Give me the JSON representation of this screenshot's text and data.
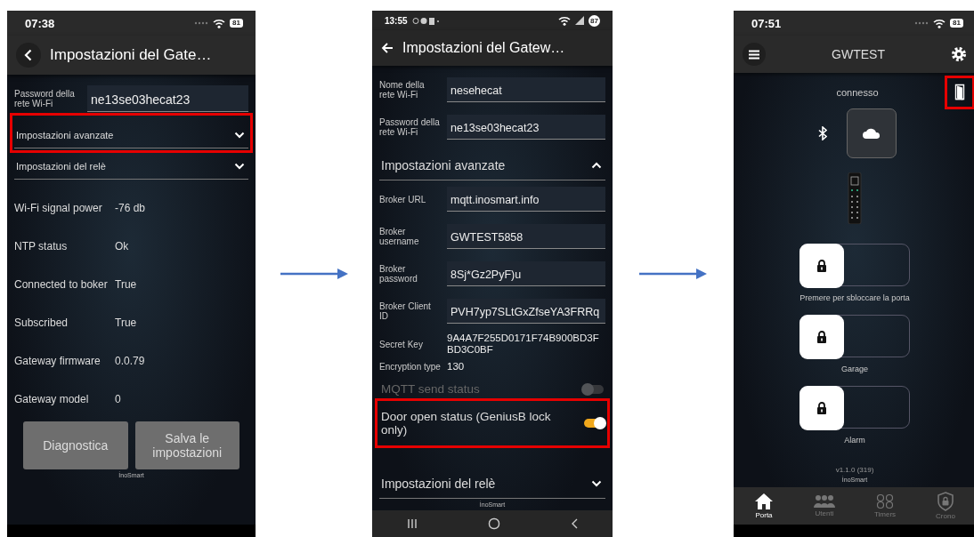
{
  "screens": [
    {
      "kind": "settings",
      "status_bar": {
        "kind": "ios",
        "time": "07:38",
        "battery": "81"
      },
      "header": {
        "title": "Impostazioni del Gate…"
      },
      "rows": [
        {
          "kind": "field",
          "label": "Password della rete Wi-Fi",
          "value": "ne13se03hecat23"
        },
        {
          "kind": "accordion",
          "title": "Impostazioni avanzate",
          "expanded": false,
          "highlighted": true
        },
        {
          "kind": "accordion",
          "title": "Impostazioni del relè",
          "expanded": false
        },
        {
          "kind": "info",
          "label": "Wi-Fi signal power",
          "value": "-76 db"
        },
        {
          "kind": "info",
          "label": "NTP status",
          "value": "Ok"
        },
        {
          "kind": "info",
          "label": "Connected to boker",
          "value": "True"
        },
        {
          "kind": "info",
          "label": "Subscribed",
          "value": "True"
        },
        {
          "kind": "info",
          "label": "Gateway firmware",
          "value": "0.0.79"
        },
        {
          "kind": "info",
          "label": "Gateway model",
          "value": "0"
        },
        {
          "kind": "buttons",
          "buttons": [
            "Diagnostica",
            "Salva le impostazioni"
          ]
        }
      ],
      "footer": "İnoSmart"
    },
    {
      "kind": "settings",
      "status_bar": {
        "kind": "android",
        "time": "13:55",
        "battery": "87"
      },
      "header": {
        "title": "Impostazioni del Gatew…"
      },
      "rows": [
        {
          "kind": "field",
          "label": "Nome della rete Wi-Fi",
          "value": "nesehecat"
        },
        {
          "kind": "field",
          "label": "Password della rete Wi-Fi",
          "value": "ne13se03hecat23"
        },
        {
          "kind": "accordion",
          "title": "Impostazioni avanzate",
          "expanded": true
        },
        {
          "kind": "field",
          "label": "Broker URL",
          "value": "mqtt.inosmart.info"
        },
        {
          "kind": "field",
          "label": "Broker username",
          "value": "GWTEST5858"
        },
        {
          "kind": "field",
          "label": "Broker password",
          "value": "8Sj*Gz2PyF)u"
        },
        {
          "kind": "field",
          "label": "Broker Client ID",
          "value": "PVH7yp7SLtGxZfseYA3FRRq"
        },
        {
          "kind": "text",
          "label": "Secret Key",
          "value": "9A4A7F255D0171F74B900BD3FBD3C0BF"
        },
        {
          "kind": "text",
          "label": "Encryption type",
          "value": "130"
        },
        {
          "kind": "toggle",
          "label": "MQTT send status",
          "on": false,
          "disabled": true
        },
        {
          "kind": "toggle",
          "label": "Door open status (GeniusB lock only)",
          "on": true,
          "disabled": false,
          "highlighted": true
        },
        {
          "kind": "accordion",
          "title": "Impostazioni del relè",
          "expanded": false
        }
      ],
      "footer": "İnoSmart"
    },
    {
      "kind": "home",
      "status_bar": {
        "kind": "ios",
        "time": "07:51",
        "battery": "81"
      },
      "header": {
        "title": "GWTEST"
      },
      "door_button": {
        "highlighted": true
      },
      "connection": "connesso",
      "cloud_selected": true,
      "switches": [
        {
          "label": "Premere per sbloccare la porta",
          "on": false
        },
        {
          "label": "Garage",
          "on": false
        },
        {
          "label": "Alarm",
          "on": false
        }
      ],
      "version": "v1.1.0 (319)",
      "footer": "İnoSmart",
      "tabs": [
        {
          "label": "Porta",
          "selected": true
        },
        {
          "label": "Utenti",
          "selected": false
        },
        {
          "label": "Timers",
          "selected": false
        },
        {
          "label": "Crono",
          "selected": false
        }
      ]
    }
  ]
}
